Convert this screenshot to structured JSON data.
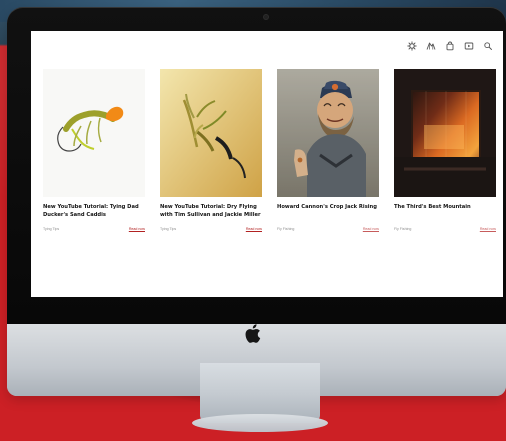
{
  "site": {
    "icons": [
      {
        "name": "settings-icon"
      },
      {
        "name": "map-icon"
      },
      {
        "name": "shopping-bag-icon"
      },
      {
        "name": "video-icon"
      },
      {
        "name": "search-icon"
      }
    ]
  },
  "articles": [
    {
      "title": "New YouTube Tutorial: Tying Dad Ducker's Sand Caddis",
      "category": "Tying Tips",
      "link": "Read now"
    },
    {
      "title": "New YouTube Tutorial: Dry Flying with Tim Sullivan and Jackie Miller",
      "category": "Tying Tips",
      "link": "Read now"
    },
    {
      "title": "Howard Cannon's Crop Jack Rising",
      "category": "Fly Fishing",
      "link": "Read now"
    },
    {
      "title": "The Third's Best Mountain",
      "category": "Fly Fishing",
      "link": "Read now"
    }
  ],
  "colors": {
    "background": "#cf1f24",
    "accent_link": "#b22222",
    "screen": "#ffffff"
  }
}
